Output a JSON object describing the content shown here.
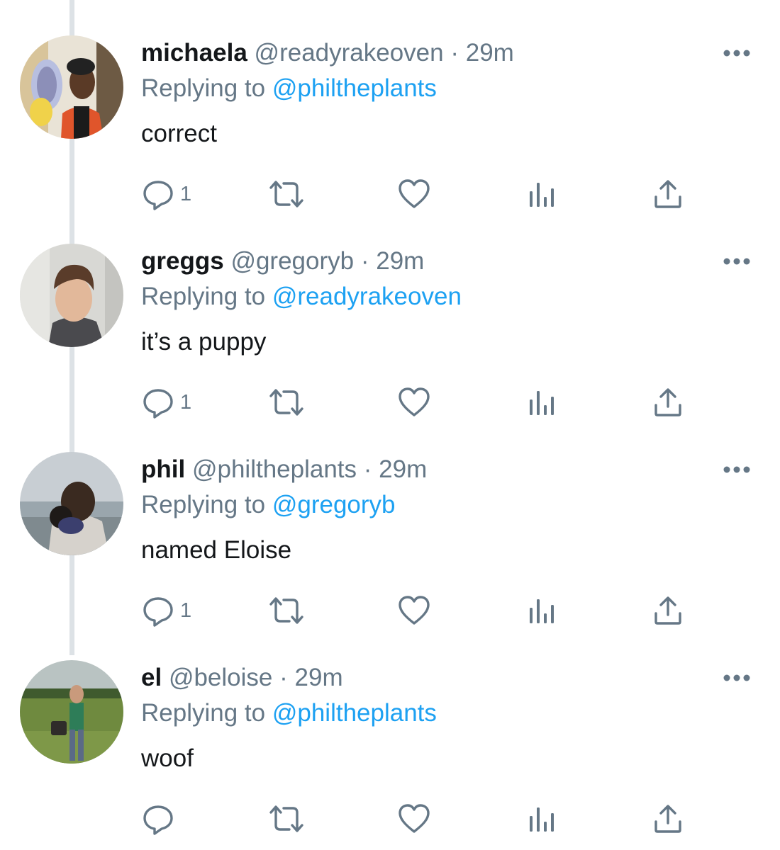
{
  "colors": {
    "link": "#1da1f2",
    "secondary_text": "#657786",
    "primary_text": "#14171a",
    "thread_line": "#dde2e6",
    "icon": "#657786"
  },
  "tweets": [
    {
      "name": "michaela",
      "handle": "@readyrakeoven",
      "separator": "·",
      "time": "29m",
      "replying_prefix": "Replying to",
      "replying_to": "@philtheplants",
      "text": "correct",
      "reply_count": "1",
      "avatar": "person-photo-avatar"
    },
    {
      "name": "greggs",
      "handle": "@gregoryb",
      "separator": "·",
      "time": "29m",
      "replying_prefix": "Replying to",
      "replying_to": "@readyrakeoven",
      "text": "it’s a puppy",
      "reply_count": "1",
      "avatar": "person-photo-avatar"
    },
    {
      "name": "phil",
      "handle": "@philtheplants",
      "separator": "·",
      "time": "29m",
      "replying_prefix": "Replying to",
      "replying_to": "@gregoryb",
      "text": "named Eloise",
      "reply_count": "1",
      "avatar": "person-photo-avatar"
    },
    {
      "name": "el",
      "handle": "@beloise",
      "separator": "·",
      "time": "29m",
      "replying_prefix": "Replying to",
      "replying_to": "@philtheplants",
      "text": "woof",
      "reply_count": "",
      "avatar": "person-photo-avatar"
    }
  ],
  "icons": {
    "reply": "reply-icon",
    "retweet": "retweet-icon",
    "like": "heart-icon",
    "analytics": "analytics-icon",
    "share": "share-icon",
    "more": "more-icon"
  }
}
